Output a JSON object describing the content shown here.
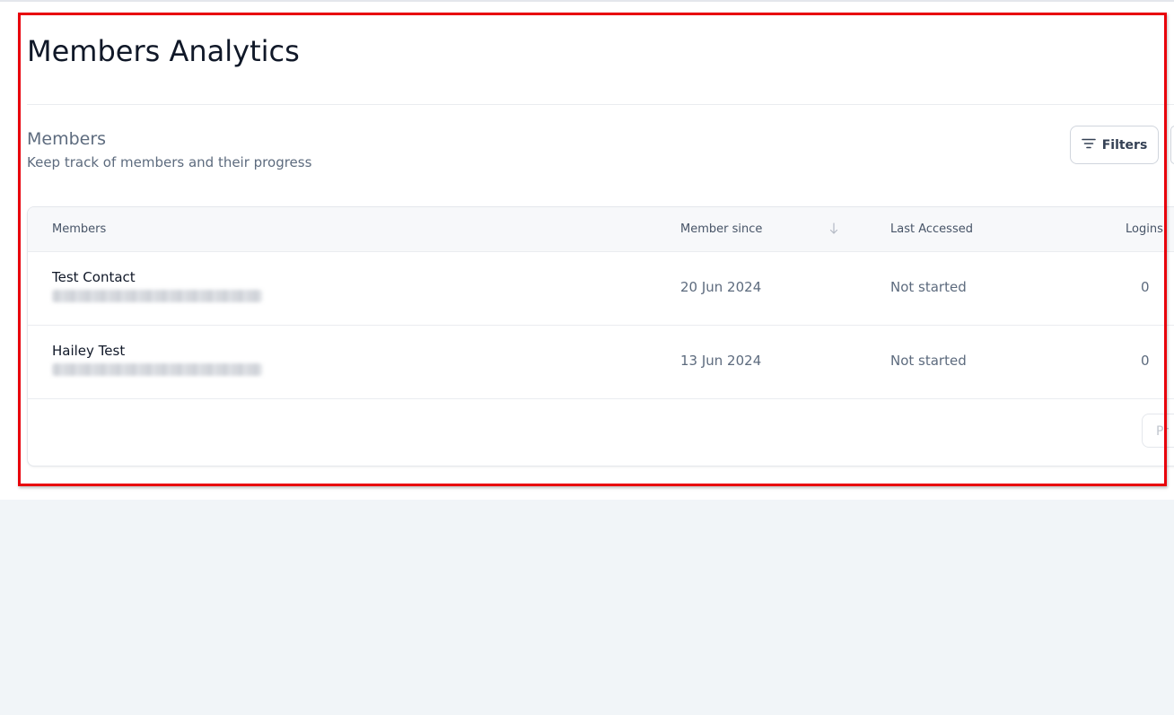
{
  "page": {
    "title": "Members Analytics"
  },
  "section": {
    "title": "Members",
    "subtitle": "Keep track of members and their progress",
    "filters_label": "Filters"
  },
  "table": {
    "columns": {
      "members": "Members",
      "member_since": "Member since",
      "last_accessed": "Last Accessed",
      "logins": "Logins"
    },
    "rows": [
      {
        "name": "Test Contact",
        "email": "",
        "member_since": "20 Jun 2024",
        "last_accessed": "Not started",
        "logins": "0"
      },
      {
        "name": "Hailey Test",
        "email": "",
        "member_since": "13 Jun 2024",
        "last_accessed": "Not started",
        "logins": "0"
      }
    ],
    "pager_label": "Pr"
  },
  "colors": {
    "highlight_border": "#e8000b",
    "background": "#f1f5f8",
    "text_primary": "#101828",
    "text_muted": "#5d6b7e"
  },
  "icons": {
    "filters": "filter-lines-icon",
    "sort": "arrow-down-icon"
  }
}
